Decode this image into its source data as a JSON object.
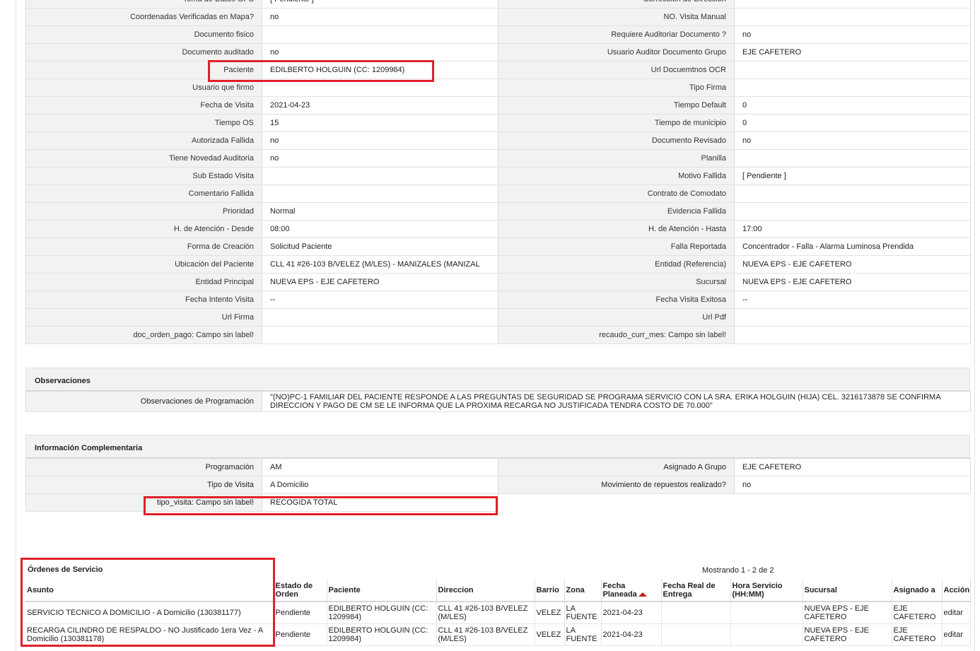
{
  "detail_rows": [
    {
      "l1": "Toma de Datos GPS",
      "v1": "[ Pendiente ]",
      "l2": "Corrección de Dirección",
      "v2": ""
    },
    {
      "l1": "Coordenadas Verificadas en Mapa?",
      "v1": "no",
      "l2": "NO. Visita Manual",
      "v2": ""
    },
    {
      "l1": "Documento fisico",
      "v1": "",
      "l2": "Requiere Auditoriar Documento ?",
      "v2": "no"
    },
    {
      "l1": "Documento auditado",
      "v1": "no",
      "l2": "Usuario Auditor Documento Grupo",
      "v2": "EJE CAFETERO"
    },
    {
      "l1": "Paciente",
      "v1": "EDILBERTO HOLGUIN (CC: 1209984)",
      "l2": "Url Docuemtnos OCR",
      "v2": ""
    },
    {
      "l1": "Usuario que firmo",
      "v1": "",
      "l2": "Tipo Firma",
      "v2": ""
    },
    {
      "l1": "Fecha de Visita",
      "v1": "2021-04-23",
      "l2": "Tiempo Default",
      "v2": "0"
    },
    {
      "l1": "Tiempo OS",
      "v1": "15",
      "l2": "Tiempo de municipio",
      "v2": "0"
    },
    {
      "l1": "Autorizada Fallida",
      "v1": "no",
      "l2": "Documento Revisado",
      "v2": "no"
    },
    {
      "l1": "Tiene Novedad Auditoria",
      "v1": "no",
      "l2": "Planilla",
      "v2": ""
    },
    {
      "l1": "Sub Estado Visita",
      "v1": "",
      "l2": "Motivo Fallida",
      "v2": "[ Pendiente ]"
    },
    {
      "l1": "Comentario Fallida",
      "v1": "",
      "l2": "Contrato de Comodato",
      "v2": ""
    },
    {
      "l1": "Prioridad",
      "v1": "Normal",
      "l2": "Evidencia Fallida",
      "v2": ""
    },
    {
      "l1": "H. de Atención - Desde",
      "v1": "08:00",
      "l2": "H. de Atención - Hasta",
      "v2": "17:00"
    },
    {
      "l1": "Forma de Creación",
      "v1": "Solicitud Paciente",
      "l2": "Falla Reportada",
      "v2": "Concentrador - Falla - Alarma Luminosa Prendida"
    },
    {
      "l1": "Ubicación del Paciente",
      "v1": "CLL 41 #26-103 B/VELEZ (M/LES) - MANIZALES (MANIZAL",
      "l2": "Entidad (Referencia)",
      "v2": "NUEVA EPS - EJE CAFETERO"
    },
    {
      "l1": "Entidad Principal",
      "v1": "NUEVA EPS - EJE CAFETERO",
      "l2": "Sucursal",
      "v2": "NUEVA EPS - EJE CAFETERO"
    },
    {
      "l1": "Fecha Intento Visita",
      "v1": "--",
      "l2": "Fecha Visita Exitosa",
      "v2": "--"
    },
    {
      "l1": "Url Firma",
      "v1": "",
      "l2": "Url Pdf",
      "v2": ""
    },
    {
      "l1": "doc_orden_pago: Campo sin label!",
      "v1": "",
      "l2": "recaudo_curr_mes: Campo sin label!",
      "v2": ""
    }
  ],
  "observaciones": {
    "title": "Observaciones",
    "label": "Observaciones de Programación",
    "text": "\"(NO)PC-1 FAMILIAR DEL PACIENTE RESPONDE A LAS PREGUNTAS DE SEGURIDAD SE PROGRAMA SERVICIO CON LA SRA. ERIKA HOLGUIN (HIJA) CEL. 3216173878 SE CONFIRMA DIRECCION Y PAGO DE CM SE LE INFORMA QUE LA PROXIMA RECARGA NO JUSTIFICADA TENDRA COSTO DE 70.000\""
  },
  "info": {
    "title": "Información Complementaria",
    "rows": [
      {
        "l1": "Programación",
        "v1": "AM",
        "l2": "Asignado A Grupo",
        "v2": "EJE CAFETERO"
      },
      {
        "l1": "Tipo de Visita",
        "v1": "A Domicilio",
        "l2": "Movimiento de repuestos realizado?",
        "v2": "no"
      }
    ],
    "last": {
      "l1": "tipo_visita: Campo sin label!",
      "v1": "RECOGIDA TOTAL"
    }
  },
  "orders": {
    "title": "Órdenes de Servicio",
    "showing_prefix": "Mostrando ",
    "showing_range": "1 - 2",
    "showing_suffix": " de 2",
    "headers": [
      "Asunto",
      "Estado de Orden",
      "Paciente",
      "Direccion",
      "Barrio",
      "Zona",
      "Fecha Planeada",
      "Fecha Real de Entrega",
      "Hora Servicio (HH:MM)",
      "Sucursal",
      "Asignado a",
      "Acción"
    ],
    "rows": [
      [
        "SERVICIO TECNICO A DOMICILIO - A Domicilio (130381177)",
        "Pendiente",
        "EDILBERTO HOLGUIN (CC: 1209984)",
        "CLL 41 #26-103 B/VELEZ (M/LES)",
        "VELEZ",
        "LA FUENTE",
        "2021-04-23",
        "",
        "",
        "NUEVA EPS - EJE CAFETERO",
        "EJE CAFETERO",
        "editar"
      ],
      [
        "RECARGA CILINDRO DE RESPALDO - NO Justificado 1era Vez - A Domicilio (130381178)",
        "Pendiente",
        "EDILBERTO HOLGUIN (CC: 1209984)",
        "CLL 41 #26-103 B/VELEZ (M/LES)",
        "VELEZ",
        "LA FUENTE",
        "2021-04-23",
        "",
        "",
        "NUEVA EPS - EJE CAFETERO",
        "EJE CAFETERO",
        "editar"
      ]
    ]
  },
  "colors": {
    "highlight": "#e0202a",
    "label_bg": "#f2f2f2"
  }
}
